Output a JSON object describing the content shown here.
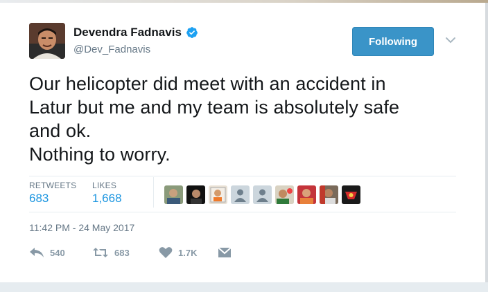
{
  "author": {
    "name": "Devendra Fadnavis",
    "handle": "@Dev_Fadnavis",
    "verified": true
  },
  "follow_button": {
    "label": "Following",
    "color": "#3a94c8"
  },
  "tweet": {
    "text": "Our helicopter did meet with an accident in\nLatur but me and my team is absolutely safe\nand ok.\nNothing to worry."
  },
  "stats": {
    "retweets_label": "RETWEETS",
    "retweets_value": "683",
    "likes_label": "LIKES",
    "likes_value": "1,668"
  },
  "likers": [
    {
      "icon": "liker-avatar-1"
    },
    {
      "icon": "liker-avatar-2"
    },
    {
      "icon": "liker-avatar-3"
    },
    {
      "icon": "default-egg-avatar"
    },
    {
      "icon": "default-egg-avatar"
    },
    {
      "icon": "liker-avatar-6"
    },
    {
      "icon": "liker-avatar-7"
    },
    {
      "icon": "liker-avatar-8"
    },
    {
      "icon": "liker-avatar-9"
    }
  ],
  "timestamp": "11:42 PM - 24 May 2017",
  "actions": {
    "reply_count": "540",
    "retweet_count": "683",
    "like_count": "1.7K"
  },
  "colors": {
    "link_blue": "#1b95e0",
    "muted_gray": "#657786",
    "icon_gray": "#8899a6",
    "verified_blue": "#1da1f2"
  }
}
